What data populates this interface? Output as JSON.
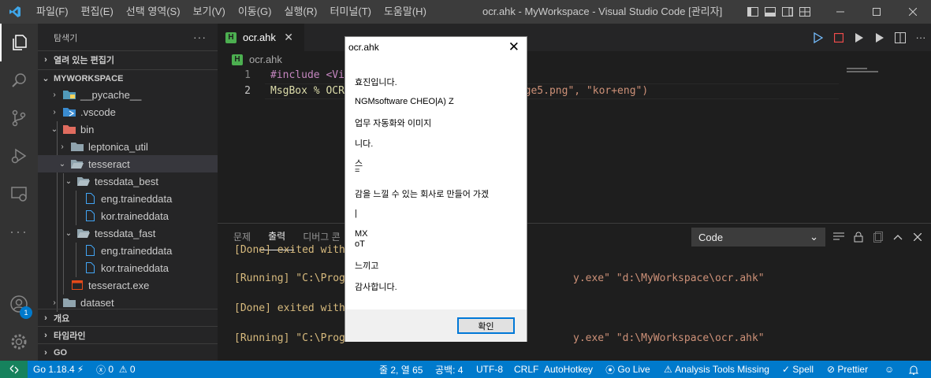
{
  "titlebar": {
    "menu": [
      "파일(F)",
      "편집(E)",
      "선택 영역(S)",
      "보기(V)",
      "이동(G)",
      "실행(R)",
      "터미널(T)",
      "도움말(H)"
    ],
    "window_title": "ocr.ahk - MyWorkspace - Visual Studio Code [관리자]"
  },
  "activity": {
    "account_badge": "1"
  },
  "sidebar": {
    "header": "탐색기",
    "more": "···",
    "open_editors": "열려 있는 편집기",
    "workspace": "MYWORKSPACE",
    "tree": [
      {
        "label": "__pycache__"
      },
      {
        "label": ".vscode"
      },
      {
        "label": "bin"
      },
      {
        "label": "leptonica_util"
      },
      {
        "label": "tesseract"
      },
      {
        "label": "tessdata_best"
      },
      {
        "label": "eng.traineddata"
      },
      {
        "label": "kor.traineddata"
      },
      {
        "label": "tessdata_fast"
      },
      {
        "label": "eng.traineddata"
      },
      {
        "label": "kor.traineddata"
      },
      {
        "label": "tesseract.exe"
      },
      {
        "label": "dataset"
      }
    ],
    "sections": [
      "개요",
      "타임라인",
      "GO"
    ]
  },
  "editor": {
    "tab_label": "ocr.ahk",
    "file_icon_letter": "H",
    "breadcrumb": "ocr.ahk",
    "lines": [
      {
        "number": "1",
        "text_a": "#include <Vi"
      },
      {
        "number": "2",
        "text_a": "MsgBox % OCR",
        "text_b": "mage5.png\", \"kor+eng\")"
      }
    ]
  },
  "panel": {
    "tabs": [
      "문제",
      "출력",
      "디버그 콘"
    ],
    "active_tab": "출력",
    "output_channel": "Code",
    "output": [
      {
        "a": "[Done] exited with"
      },
      {
        "a": "[Running] \"C:\\Progr",
        "b": "y.exe\" \"d:\\MyWorkspace\\ocr.ahk\""
      },
      {
        "a": "[Done] exited with"
      },
      {
        "a": "[Running] \"C:\\Progr",
        "b": "y.exe\" \"d:\\MyWorkspace\\ocr.ahk\""
      }
    ]
  },
  "dialog": {
    "title": "ocr.ahk",
    "lines": [
      "효진입니다.",
      "NGMsoftware CHEO|A) Z",
      "업무 자동화와 이미지",
      "니다.",
      "스",
      "=",
      "감을 느낄 수 있는 회사로 만들어 가겠",
      "|",
      "MX",
      "oT",
      "느끼고",
      "감사합니다."
    ],
    "ok_label": "확인"
  },
  "status": {
    "go_version": "Go 1.18.4",
    "errors": "0",
    "warnings": "0",
    "position": "줄 2, 열 65",
    "spaces": "공백: 4",
    "encoding": "UTF-8",
    "eol": "CRLF",
    "language": "AutoHotkey",
    "go_live": "Go Live",
    "analysis": "Analysis Tools Missing",
    "spell": "Spell",
    "prettier": "Prettier"
  },
  "colors": {
    "statusbar": "#007acc",
    "remote": "#16825d",
    "keyword": "#c586c0",
    "string": "#ce9178",
    "run_icon": "#75beff",
    "stop_icon": "#f14c4c"
  }
}
